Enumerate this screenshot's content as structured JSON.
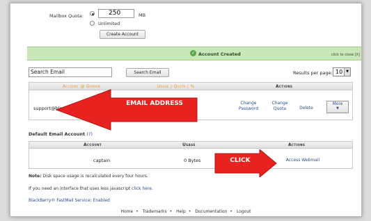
{
  "quota": {
    "label": "Mailbox Quota:",
    "value": "250",
    "unit": "MB",
    "unlimited_label": "Unlimited",
    "create_button": "Create Account"
  },
  "status": {
    "message": "Account Created",
    "hide_link": "click to close [X]"
  },
  "search": {
    "value": "Search Email",
    "button": "Search Email",
    "results_label": "Results per page:",
    "results_value": "10"
  },
  "accounts_table": {
    "col_account": "Account @ Domain",
    "col_usage": "Usage / Quota / %",
    "col_actions": "Actions",
    "row": {
      "email": "support@blogmarketingsystem.com",
      "change_password": "Change Password",
      "change_quota": "Change Quota",
      "delete": "Delete",
      "more": "More"
    }
  },
  "default_section": {
    "title": "Default Email Account",
    "help": "(?)",
    "col_account": "Account",
    "col_usage": "Usage",
    "col_actions": "Actions",
    "account": "captain",
    "usage": "0 Bytes",
    "webmail": "Access Webmail"
  },
  "notes": {
    "note_bold": "Note:",
    "note_text": "Disk space usage is recalculated every four hours.",
    "interface_text": "If you need an interface that uses less javascript",
    "interface_link": "click here.",
    "blackberry": "BlackBerry® FastMail Service: Enabled"
  },
  "footer": [
    "Home",
    "Trademarks",
    "Help",
    "Documentation",
    "Logout"
  ],
  "annotations": {
    "email_callout": "EMAIL ADDRESS",
    "click_callout": "CLICK"
  },
  "colors": {
    "callout_red": "#e8231f",
    "success_green": "#c8e8b9",
    "header_orange": "#e89a27",
    "link_blue": "#2a4c8c"
  }
}
